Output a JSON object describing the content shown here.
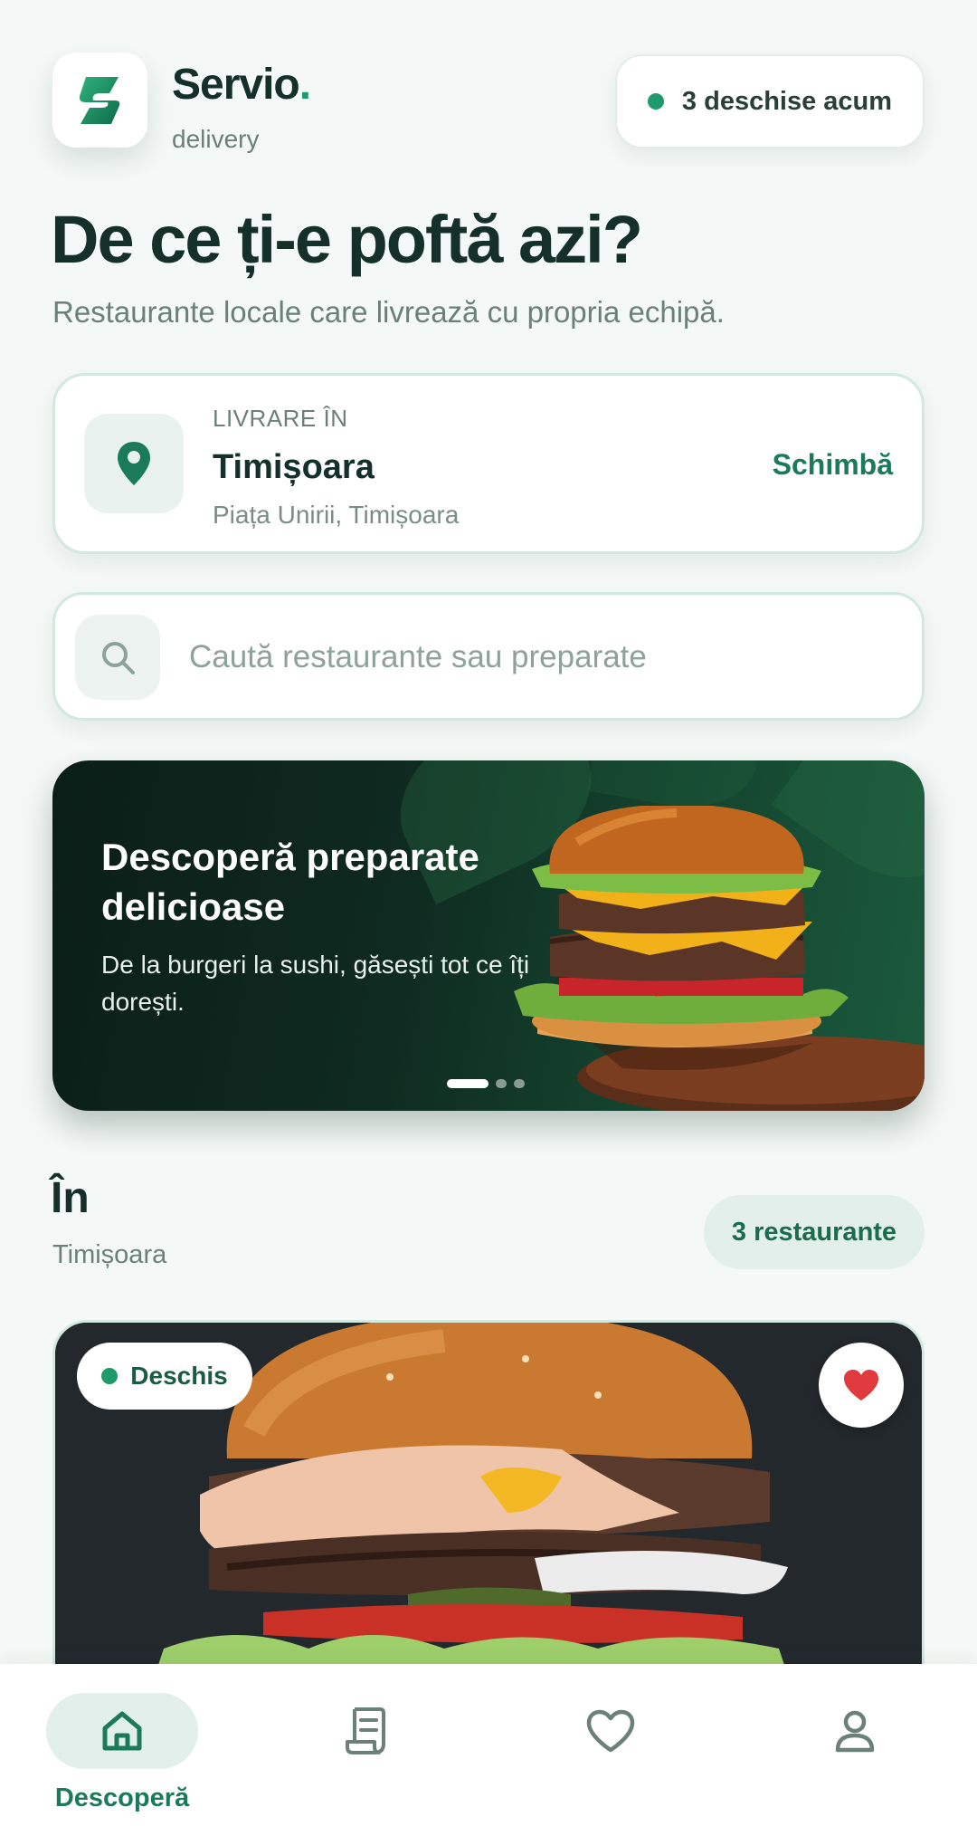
{
  "brand": {
    "name": "Servio",
    "dot": ".",
    "subtitle": "delivery"
  },
  "open_status": {
    "label": "3 deschise acum"
  },
  "hero": {
    "title": "De ce ți-e poftă azi?",
    "subtitle": "Restaurante locale care livrează cu propria echipă."
  },
  "location": {
    "label": "LIVRARE ÎN",
    "city": "Timișoara",
    "address": "Piața Unirii, Timișoara",
    "change_label": "Schimbă"
  },
  "search": {
    "placeholder": "Caută restaurante sau preparate"
  },
  "banner": {
    "title": "Descoperă preparate delicioase",
    "subtitle": "De la burgeri la sushi, găsești tot ce îți dorești.",
    "slides": 3,
    "active_slide": 1
  },
  "section": {
    "title": "În",
    "subtitle": "Timișoara",
    "count_label": "3 restaurante"
  },
  "restaurant_card": {
    "status": "Deschis",
    "favorited": true
  },
  "nav": {
    "items": [
      {
        "label": "Descoperă",
        "icon": "home-icon",
        "active": true
      },
      {
        "label": "",
        "icon": "orders-icon",
        "active": false
      },
      {
        "label": "",
        "icon": "heart-icon",
        "active": false
      },
      {
        "label": "",
        "icon": "profile-icon",
        "active": false
      }
    ]
  },
  "colors": {
    "accent": "#1b7a5a",
    "dark": "#143029",
    "background": "#f4f8f6",
    "favorite": "#e0393e"
  }
}
